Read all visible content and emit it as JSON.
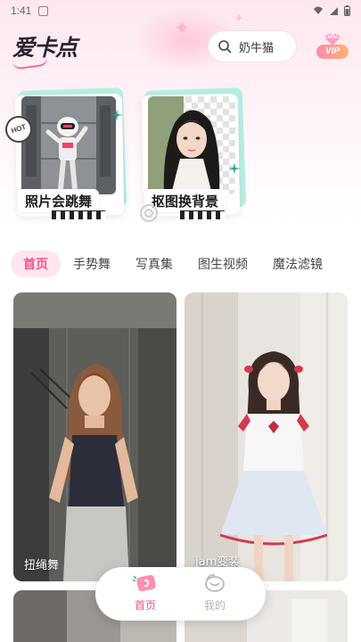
{
  "status_bar": {
    "time": "1:41"
  },
  "header": {
    "logo_text": "爱卡点",
    "search": {
      "value": "奶牛猫"
    },
    "vip_label": "VIP"
  },
  "features": [
    {
      "label": "照片会跳舞",
      "tag": "HOT"
    },
    {
      "label": "抠图换背景"
    }
  ],
  "tabs": [
    {
      "label": "首页",
      "active": true
    },
    {
      "label": "手势舞",
      "active": false
    },
    {
      "label": "写真集",
      "active": false
    },
    {
      "label": "图生视频",
      "active": false
    },
    {
      "label": "魔法滤镜",
      "active": false
    }
  ],
  "videos": [
    {
      "caption": "扭绳舞"
    },
    {
      "caption": "jam变装"
    }
  ],
  "bottom_nav": [
    {
      "label": "首页",
      "active": true
    },
    {
      "label": "我的",
      "active": false
    }
  ],
  "colors": {
    "accent": "#ff4f86",
    "tab_bg": "#ffe6ee",
    "mint": "#b5f0e4"
  }
}
